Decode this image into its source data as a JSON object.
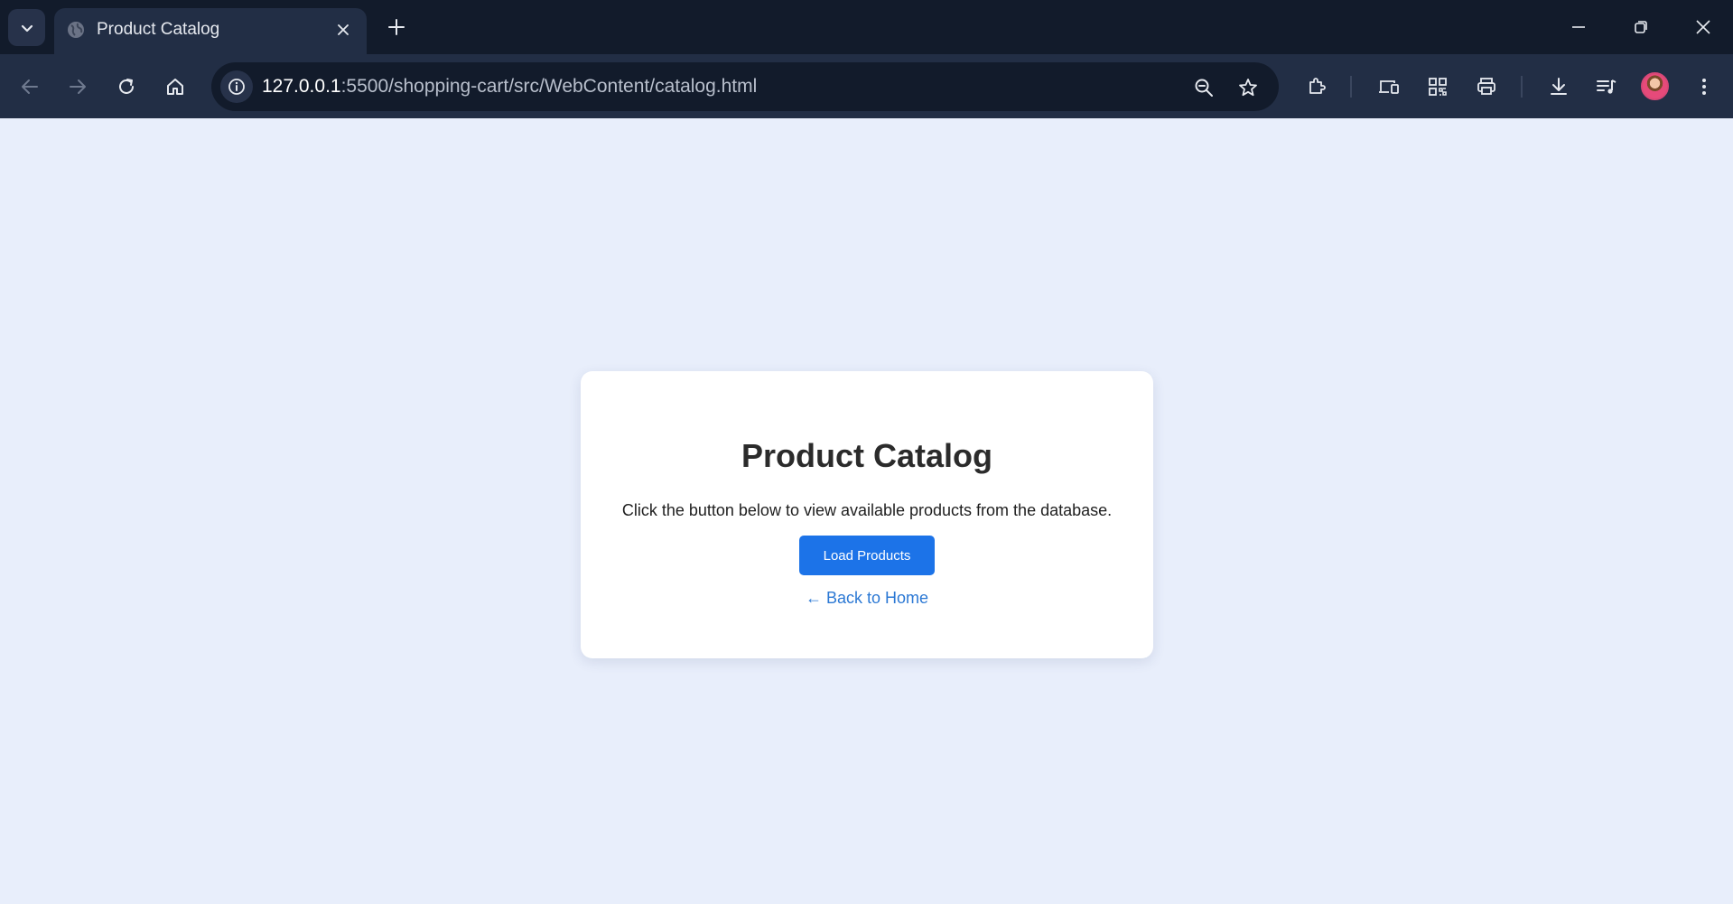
{
  "browser": {
    "tab": {
      "title": "Product Catalog"
    },
    "address_bar": {
      "url_host": "127.0.0.1",
      "url_rest": ":5500/shopping-cart/src/WebContent/catalog.html"
    },
    "icons": {
      "tab_search": "chevron-down-icon",
      "tab_favicon": "globe-icon",
      "tab_close": "close-icon",
      "new_tab": "plus-icon",
      "minimize": "minimize-icon",
      "restore": "restore-icon",
      "close_window": "close-icon",
      "back": "arrow-left-icon",
      "forward": "arrow-right-icon",
      "reload": "reload-icon",
      "home": "home-icon",
      "site_info": "info-icon",
      "zoom": "zoom-out-icon",
      "bookmark": "star-icon",
      "extensions": "puzzle-icon",
      "devices": "devices-icon",
      "qr": "qr-code-icon",
      "print": "printer-icon",
      "downloads": "download-icon",
      "media": "media-queue-icon",
      "profile": "avatar",
      "menu": "kebab-menu-icon"
    },
    "colors": {
      "tabbar_bg": "#121b2b",
      "toolbar_bg": "#222e45"
    }
  },
  "page": {
    "heading": "Product Catalog",
    "description": "Click the button below to view available products from the database.",
    "load_button_label": "Load Products",
    "back_link_label": "← Back to Home",
    "colors": {
      "background": "#e8eefb",
      "card": "#ffffff",
      "button": "#1c73e8",
      "link": "#2b78d4"
    }
  }
}
